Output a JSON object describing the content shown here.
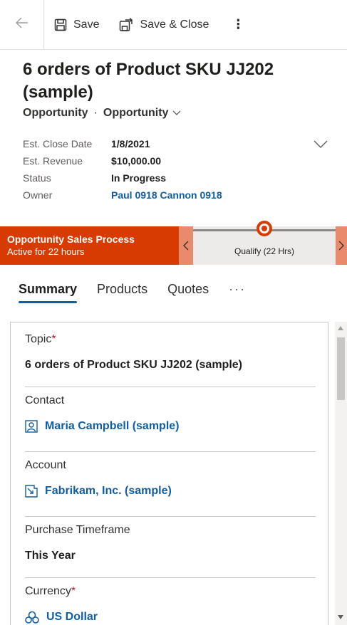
{
  "toolbar": {
    "save_label": "Save",
    "save_close_label": "Save & Close",
    "more_label": "⋮"
  },
  "header": {
    "title": "6 orders of Product SKU JJ202 (sample)",
    "entity": "Opportunity",
    "separator": "·",
    "form": "Opportunity",
    "fields": [
      {
        "label": "Est. Close Date",
        "value": "1/8/2021"
      },
      {
        "label": "Est. Revenue",
        "value": "$10,000.00"
      },
      {
        "label": "Status",
        "value": "In Progress"
      },
      {
        "label": "Owner",
        "value": "Paul 0918 Cannon 0918"
      }
    ]
  },
  "bpf": {
    "process_name": "Opportunity Sales Process",
    "active_for": "Active for 22 hours",
    "stage_label": "Qualify  (22 Hrs)",
    "accent": "#d83b01"
  },
  "tabs": [
    {
      "label": "Summary",
      "active": true
    },
    {
      "label": "Products"
    },
    {
      "label": "Quotes"
    },
    {
      "label": "···"
    }
  ],
  "form": {
    "topic": {
      "label": "Topic",
      "required": "*",
      "value": "6 orders of Product SKU JJ202 (sample)"
    },
    "contact": {
      "label": "Contact",
      "value": "Maria Campbell (sample)",
      "icon": "contact-icon"
    },
    "account": {
      "label": "Account",
      "value": "Fabrikam, Inc. (sample)",
      "icon": "account-icon"
    },
    "purchase_timeframe": {
      "label": "Purchase Timeframe",
      "value": "This Year"
    },
    "currency": {
      "label": "Currency",
      "required": "*",
      "value": "US Dollar",
      "icon": "currency-icon"
    }
  },
  "colors": {
    "link": "#115ea3",
    "required": "#a4262c",
    "accent": "#d83b01"
  }
}
